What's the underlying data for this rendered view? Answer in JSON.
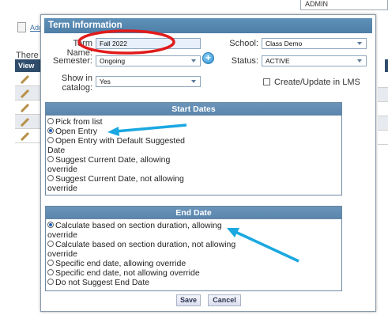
{
  "background": {
    "admin_label": "ADMIN",
    "add_link": "Add",
    "there_text": "There a",
    "table_header": "View"
  },
  "dialog": {
    "title": "Term Information",
    "term_name": {
      "label": "Term Name:",
      "value": "Fall 2022"
    },
    "school": {
      "label": "School:",
      "value": "Class Demo"
    },
    "semester": {
      "label": "Semester:",
      "value": "Ongoing"
    },
    "status": {
      "label": "Status:",
      "value": "ACTIVE"
    },
    "show_in_catalog": {
      "label": "Show in\ncatalog:",
      "value": "Yes"
    },
    "lms_checkbox_label": "Create/Update in LMS",
    "start_dates": {
      "title": "Start Dates",
      "options": [
        {
          "label": "Pick from list",
          "selected": false
        },
        {
          "label": "Open Entry",
          "selected": true
        },
        {
          "label": "Open Entry with Default Suggested\nDate",
          "selected": false
        },
        {
          "label": "Suggest Current Date, allowing\noverride",
          "selected": false
        },
        {
          "label": "Suggest Current Date, not allowing\noverride",
          "selected": false
        }
      ]
    },
    "end_date": {
      "title": "End Date",
      "options": [
        {
          "label": "Calculate based on section duration, allowing\noverride",
          "selected": true
        },
        {
          "label": "Calculate based on section duration, not allowing\noverride",
          "selected": false
        },
        {
          "label": "Specific end date, allowing override",
          "selected": false
        },
        {
          "label": "Specific end date, not allowing override",
          "selected": false
        },
        {
          "label": "Do not Suggest End Date",
          "selected": false
        }
      ]
    },
    "save_label": "Save",
    "cancel_label": "Cancel"
  },
  "annotation_colors": {
    "circle": "#e01b1b",
    "arrow": "#1aa8e0"
  },
  "icons": {
    "add": "plus-circle-icon",
    "edit": "pencil-icon"
  }
}
